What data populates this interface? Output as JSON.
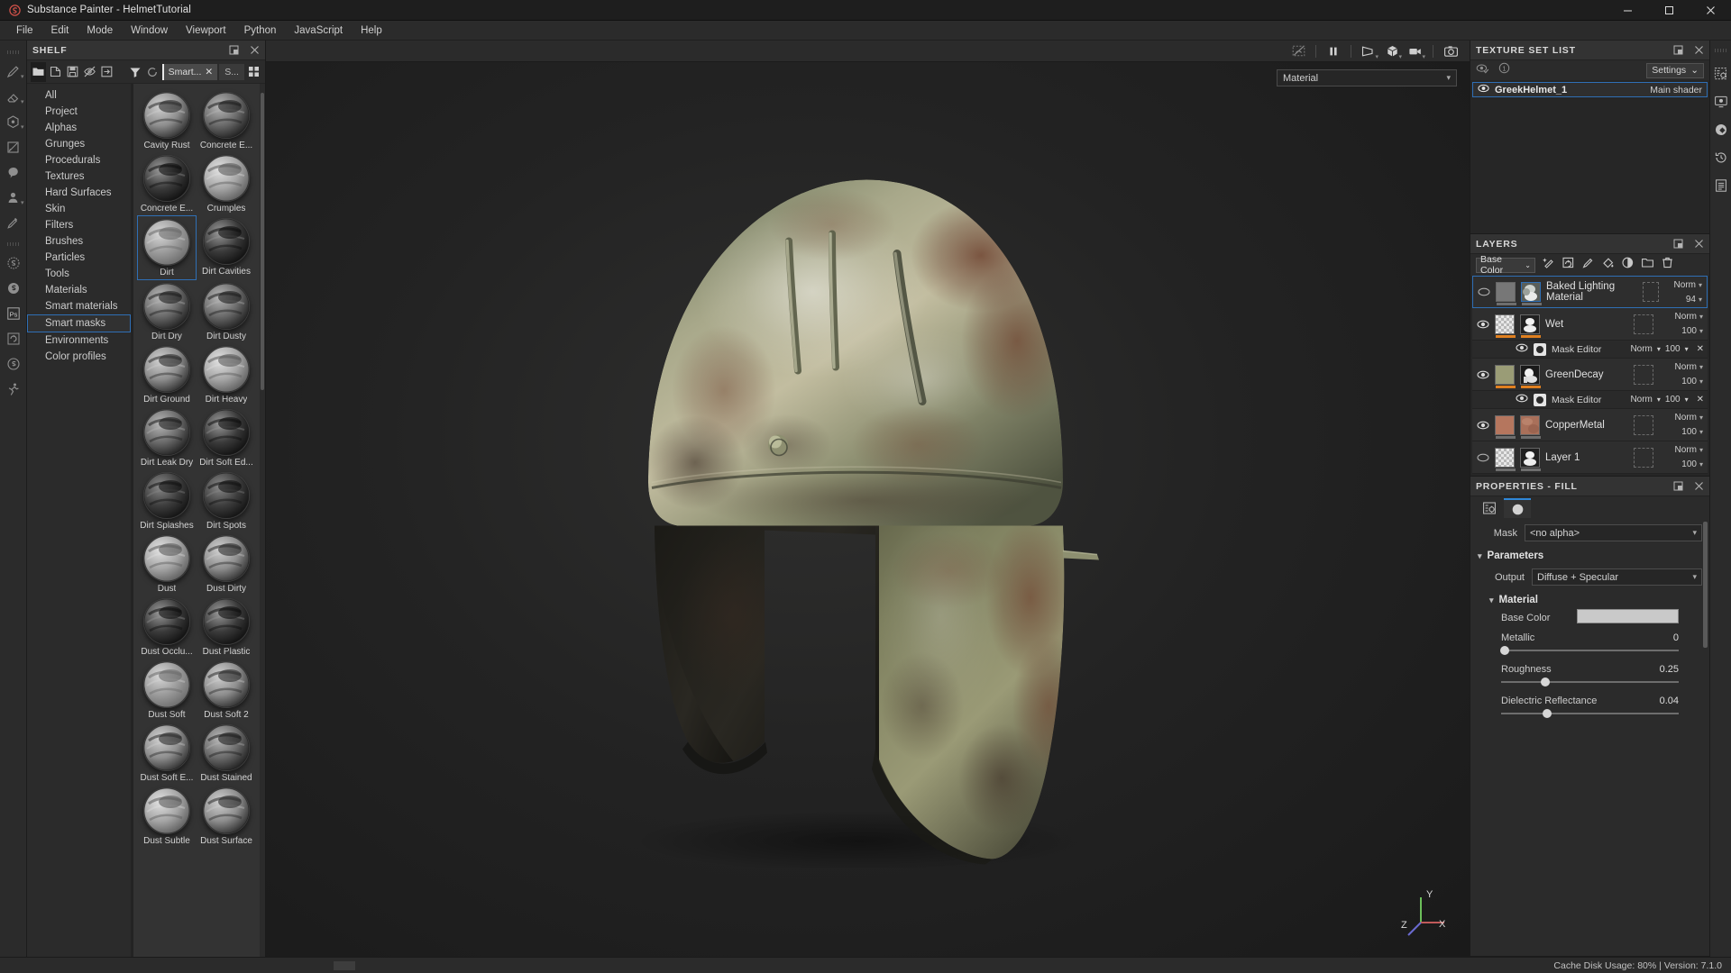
{
  "window": {
    "app_title": "Substance Painter - HelmetTutorial",
    "app_icon": "substance-painter-icon",
    "minimize": "–",
    "maximize": "❐",
    "close": "✕"
  },
  "menubar": {
    "items": [
      "File",
      "Edit",
      "Mode",
      "Window",
      "Viewport",
      "Python",
      "JavaScript",
      "Help"
    ]
  },
  "left_toolbar": {
    "tools": [
      {
        "name": "paint-brush-tool",
        "caret": true
      },
      {
        "name": "eraser-tool",
        "caret": true
      },
      {
        "name": "projection-tool",
        "caret": true
      },
      {
        "name": "polygon-fill-tool",
        "caret": false
      },
      {
        "name": "smudge-tool",
        "caret": false
      },
      {
        "name": "clone-stamp-tool",
        "caret": true
      },
      {
        "name": "material-picker-tool",
        "caret": false
      }
    ],
    "plugins": [
      {
        "name": "substance-source-icon"
      },
      {
        "name": "substance-share-icon"
      },
      {
        "name": "photoshop-link-icon",
        "label": "Ps"
      },
      {
        "name": "iray-render-icon"
      },
      {
        "name": "substance-logo-icon"
      },
      {
        "name": "mixamo-icon"
      }
    ]
  },
  "shelf": {
    "title": "SHELF",
    "toolbar": [
      {
        "name": "folder-view-button",
        "active": true
      },
      {
        "name": "new-resource-button",
        "active": false
      },
      {
        "name": "save-resource-button",
        "active": false
      },
      {
        "name": "hide-resource-button",
        "active": false
      },
      {
        "name": "import-resource-button",
        "active": false
      }
    ],
    "filter_icon": "filter-icon",
    "refresh_icon": "refresh-icon",
    "search_chip": "Smart...",
    "search_chip_close": "✕",
    "search_chip2": "S...",
    "grid_view_icon": "grid-view-icon",
    "categories": [
      "All",
      "Project",
      "Alphas",
      "Grunges",
      "Procedurals",
      "Textures",
      "Hard Surfaces",
      "Skin",
      "Filters",
      "Brushes",
      "Particles",
      "Tools",
      "Materials",
      "Smart materials",
      "Smart masks",
      "Environments",
      "Color profiles"
    ],
    "selected_category": "Smart masks",
    "assets": [
      {
        "label": "Cavity Rust",
        "selected": false,
        "tone": "rings"
      },
      {
        "label": "Concrete E...",
        "selected": false,
        "tone": "speckle"
      },
      {
        "label": "Concrete E...",
        "selected": false,
        "tone": "dark-rings"
      },
      {
        "label": "Crumples",
        "selected": false,
        "tone": "light-noise"
      },
      {
        "label": "Dirt",
        "selected": true,
        "tone": "light-grain"
      },
      {
        "label": "Dirt Cavities",
        "selected": false,
        "tone": "dark-rings"
      },
      {
        "label": "Dirt Dry",
        "selected": false,
        "tone": "speckle"
      },
      {
        "label": "Dirt Dusty",
        "selected": false,
        "tone": "speckle"
      },
      {
        "label": "Dirt Ground",
        "selected": false,
        "tone": "rings"
      },
      {
        "label": "Dirt Heavy",
        "selected": false,
        "tone": "light-noise"
      },
      {
        "label": "Dirt Leak Dry",
        "selected": false,
        "tone": "speckle"
      },
      {
        "label": "Dirt Soft Ed...",
        "selected": false,
        "tone": "dark-rings"
      },
      {
        "label": "Dirt Splashes",
        "selected": false,
        "tone": "dark-blob"
      },
      {
        "label": "Dirt Spots",
        "selected": false,
        "tone": "dark-blob"
      },
      {
        "label": "Dust",
        "selected": false,
        "tone": "light-noise"
      },
      {
        "label": "Dust Dirty",
        "selected": false,
        "tone": "rings"
      },
      {
        "label": "Dust Occlu...",
        "selected": false,
        "tone": "dark-rings"
      },
      {
        "label": "Dust Plastic",
        "selected": false,
        "tone": "dark-rings"
      },
      {
        "label": "Dust Soft",
        "selected": false,
        "tone": "light-grain"
      },
      {
        "label": "Dust Soft 2",
        "selected": false,
        "tone": "rings"
      },
      {
        "label": "Dust Soft E...",
        "selected": false,
        "tone": "rings"
      },
      {
        "label": "Dust Stained",
        "selected": false,
        "tone": "speckle"
      },
      {
        "label": "Dust Subtle",
        "selected": false,
        "tone": "light-noise"
      },
      {
        "label": "Dust Surface",
        "selected": false,
        "tone": "rings"
      }
    ]
  },
  "viewport": {
    "toolbar": [
      {
        "name": "toggle-uv-overlay-button",
        "caret": false
      },
      {
        "name": "pause-engine-button",
        "caret": false
      },
      {
        "name": "camera-perspective-button",
        "caret": true
      },
      {
        "name": "display-3d-mesh-button",
        "caret": true
      },
      {
        "name": "render-mode-button",
        "caret": true
      },
      {
        "name": "screenshot-button",
        "caret": false
      }
    ],
    "material_dropdown": "Material",
    "axis_labels": {
      "x": "X",
      "y": "Y",
      "z": "Z"
    },
    "axis_colors": {
      "x": "#c05a5a",
      "y": "#6cbf5a",
      "z": "#6a6ad0"
    }
  },
  "texture_set_list": {
    "title": "TEXTURE SET LIST",
    "dock_icon": "dock-icon",
    "close_icon": "close-icon",
    "visibility_icon": "eye-check-icon",
    "info_icon": "info-icon",
    "settings_label": "Settings",
    "settings_caret": "⌄",
    "rows": [
      {
        "name": "GreekHelmet_1",
        "shader": "Main shader",
        "visible": true,
        "selected": true
      }
    ]
  },
  "layers_panel": {
    "title": "LAYERS",
    "dock_icon": "dock-icon",
    "close_icon": "close-icon",
    "channel_selector": "Base Color",
    "channel_caret": "⌄",
    "toolbar_icons": [
      "add-effect-icon",
      "add-mask-icon",
      "add-paint-layer-icon",
      "add-fill-layer-icon",
      "add-adjustment-icon",
      "add-folder-icon",
      "delete-layer-icon"
    ],
    "layers": [
      {
        "name": "Baked Lighting Material",
        "visible": false,
        "selected": true,
        "blend": "Norm",
        "opacity": "94",
        "thumb": "baked-lighting",
        "underbar": "grey",
        "type": "fill",
        "mask": null
      },
      {
        "name": "Wet",
        "visible": true,
        "selected": false,
        "blend": "Norm",
        "opacity": "100",
        "thumb": "checker",
        "underbar": "orange",
        "type": "fill",
        "mask": {
          "label": "Mask Editor",
          "visible": true,
          "blend": "Norm",
          "opacity": "100",
          "close": "✕"
        }
      },
      {
        "name": "GreenDecay",
        "visible": true,
        "selected": false,
        "blend": "Norm",
        "opacity": "100",
        "thumb": "green",
        "underbar": "orange",
        "type": "fill",
        "mask": {
          "label": "Mask Editor",
          "visible": true,
          "blend": "Norm",
          "opacity": "100",
          "close": "✕"
        }
      },
      {
        "name": "CopperMetal",
        "visible": true,
        "selected": false,
        "blend": "Norm",
        "opacity": "100",
        "thumb": "copper",
        "underbar": "grey",
        "type": "fill",
        "mask": null
      },
      {
        "name": "Layer 1",
        "visible": false,
        "selected": false,
        "blend": "Norm",
        "opacity": "100",
        "thumb": "checker",
        "underbar": "grey",
        "type": "paint",
        "mask": null
      }
    ]
  },
  "properties": {
    "title": "PROPERTIES - FILL",
    "dock_icon": "dock-icon",
    "close_icon": "close-icon",
    "tabs": [
      {
        "name": "properties-settings-tab",
        "active": false
      },
      {
        "name": "properties-material-tab",
        "active": true
      }
    ],
    "mask_label": "Mask",
    "mask_value": "<no alpha>",
    "parameters_label": "Parameters",
    "output_label": "Output",
    "output_value": "Diffuse + Specular",
    "material_label": "Material",
    "base_color_label": "Base Color",
    "base_color_value": "#c9c9c9",
    "sliders": [
      {
        "label": "Metallic",
        "value": "0",
        "pct": 2
      },
      {
        "label": "Roughness",
        "value": "0.25",
        "pct": 25
      },
      {
        "label": "Dielectric Reflectance",
        "value": "0.04",
        "pct": 26
      }
    ]
  },
  "right_rail": {
    "icons": [
      "texture-set-settings-icon",
      "display-settings-icon",
      "shader-settings-icon",
      "history-icon",
      "log-icon"
    ]
  },
  "statusbar": {
    "cache_label": "Cache Disk Usage:",
    "cache_value": "80%",
    "separator": "|",
    "version_label": "Version: 7.1.0"
  },
  "theme": {
    "accent": "#2f6fb5",
    "panel_bg": "#2b2b2b",
    "dark_bg": "#262626",
    "orange": "#e08020"
  }
}
